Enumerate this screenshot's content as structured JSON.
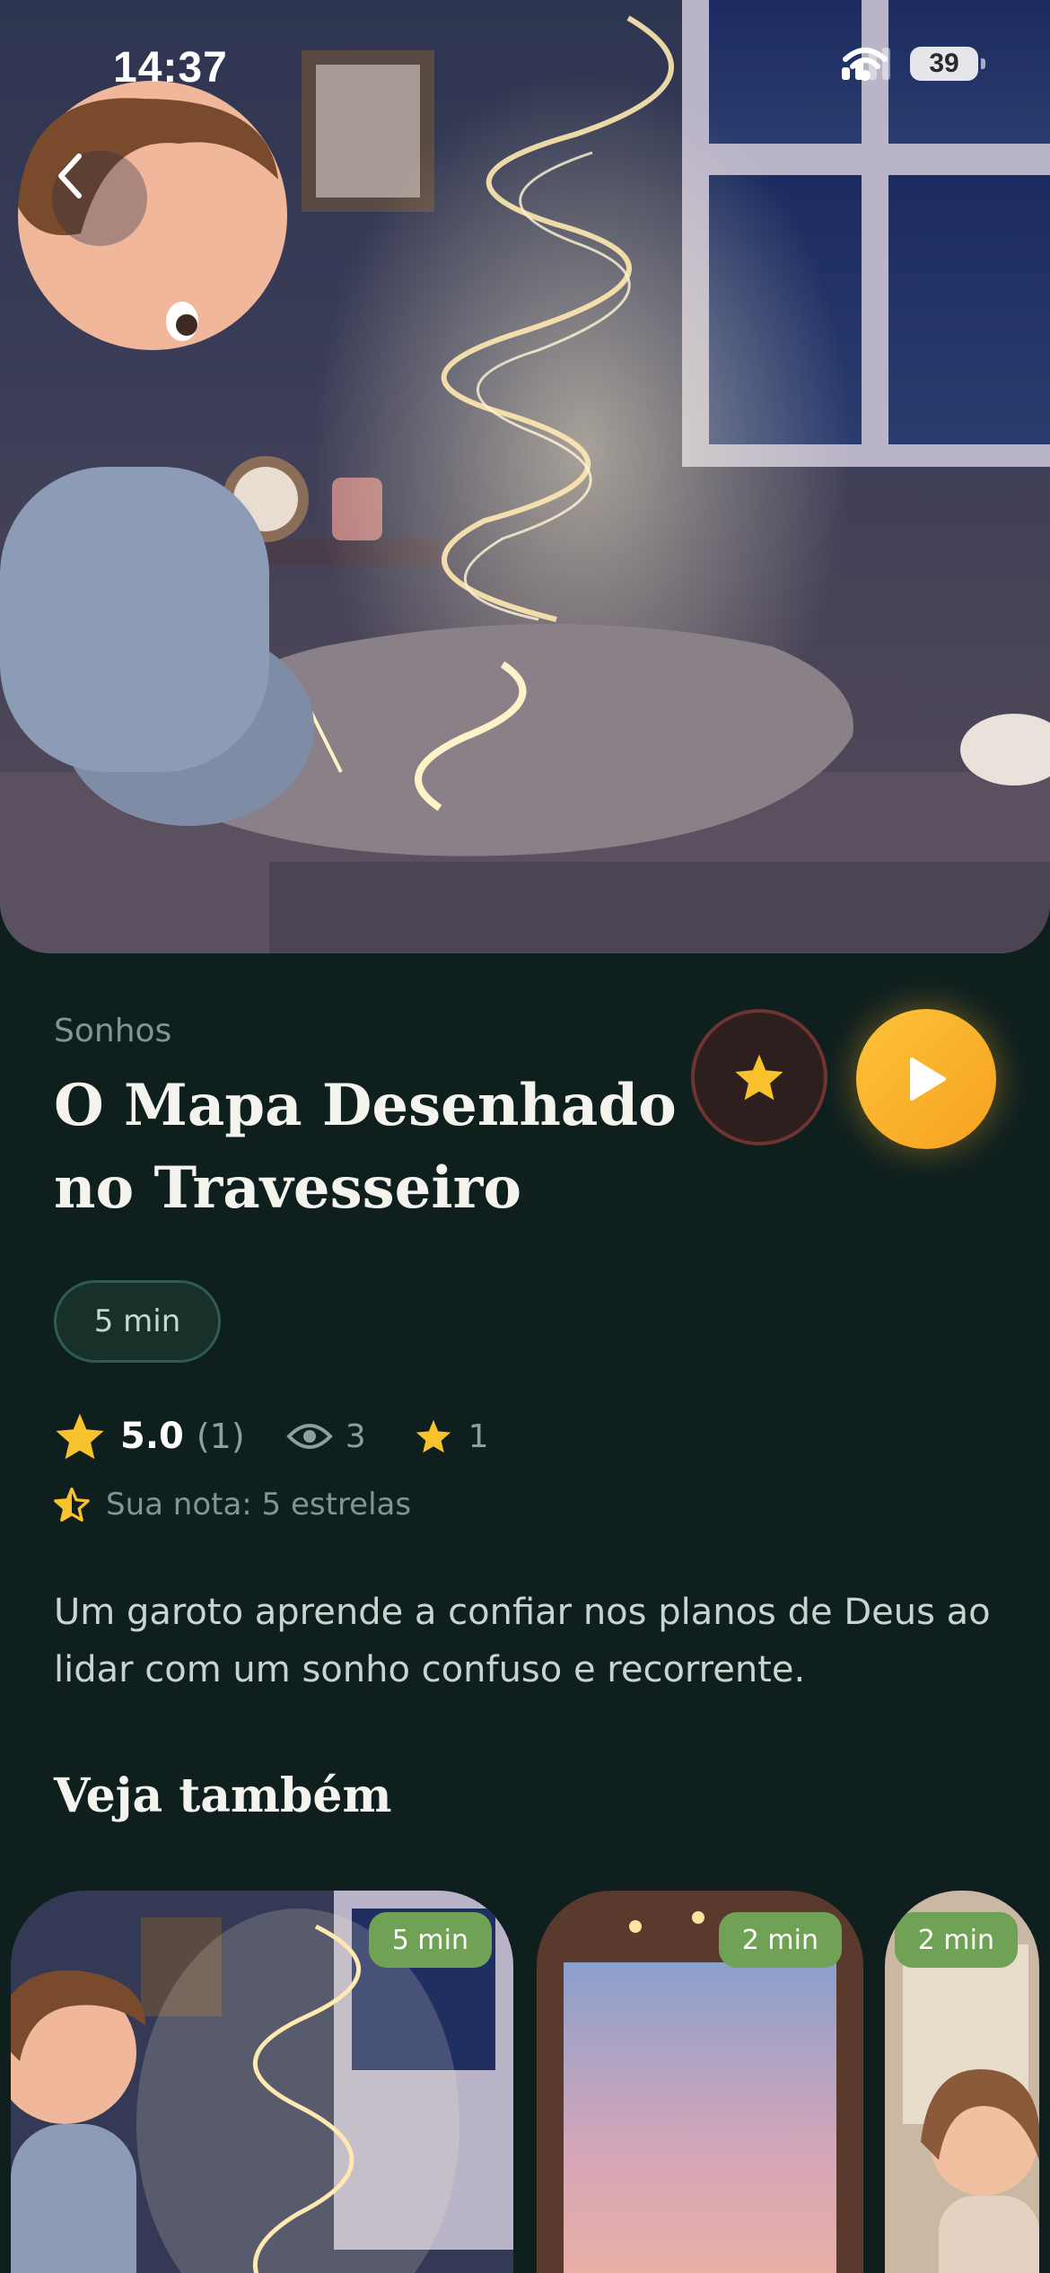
{
  "status_bar": {
    "time": "14:37",
    "battery": "39"
  },
  "hero": {
    "image_desc": "boy-with-glowing-pillow-illustration"
  },
  "story": {
    "category": "Sonhos",
    "title": "O Mapa Desenhado no Travesseiro",
    "duration": "5 min",
    "rating": "5.0",
    "rating_count": "(1)",
    "views": "3",
    "favorites": "1",
    "your_rating": "Sua nota: 5 estrelas",
    "description": "Um garoto aprende a confiar nos planos de Deus ao lidar com um sonho confuso e recorrente."
  },
  "related": {
    "title": "Veja também",
    "cards": [
      {
        "duration": "5 min"
      },
      {
        "duration": "2 min"
      },
      {
        "duration": "2 min"
      }
    ]
  },
  "colors": {
    "background": "#0e1f1e",
    "accent": "#f7a21f",
    "star": "#f7c22b",
    "badge": "#6fa255"
  }
}
